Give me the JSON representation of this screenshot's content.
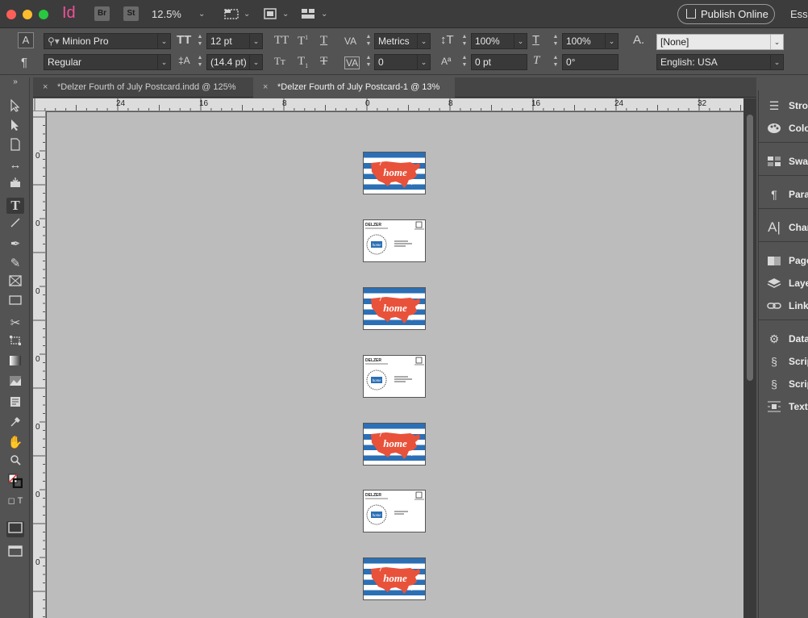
{
  "titlebar": {
    "app_logo": "Id",
    "bridge_label": "Br",
    "stock_label": "St",
    "zoom": "12.5%",
    "publish_label": "Publish Online",
    "workspace_label": "Ess"
  },
  "control": {
    "font_family": "Minion Pro",
    "font_style": "Regular",
    "font_size": "12 pt",
    "leading": "(14.4 pt)",
    "kerning": "Metrics",
    "tracking": "0",
    "vertical_scale": "100%",
    "horizontal_scale": "100%",
    "baseline_shift": "0 pt",
    "skew": "0°",
    "char_style": "[None]",
    "language": "English: USA"
  },
  "tabs": [
    {
      "label": "*Delzer Fourth of July Postcard.indd @ 125%"
    },
    {
      "label": "*Delzer Fourth of July Postcard-1 @ 13%"
    }
  ],
  "ruler": {
    "h_labels": [
      "24",
      "16",
      "8",
      "0",
      "8",
      "16",
      "24",
      "32"
    ],
    "v_labels": [
      "0",
      "0",
      "0",
      "0",
      "0",
      "0",
      "0"
    ]
  },
  "postcard": {
    "front_text": "home",
    "back_brand": "DELZER"
  },
  "panels": [
    {
      "label": "Strol",
      "icon": "stroke-icon"
    },
    {
      "label": "Colo",
      "icon": "color-icon"
    },
    {
      "label": "Swat",
      "icon": "swatches-icon"
    },
    {
      "label": "Para",
      "icon": "paragraph-icon"
    },
    {
      "label": "Char",
      "icon": "character-icon"
    },
    {
      "label": "Page",
      "icon": "pages-icon"
    },
    {
      "label": "Laye",
      "icon": "layers-icon"
    },
    {
      "label": "Link",
      "icon": "links-icon"
    },
    {
      "label": "Data",
      "icon": "data-merge-icon"
    },
    {
      "label": "Scrip",
      "icon": "scripts-icon"
    },
    {
      "label": "Scrip",
      "icon": "script-label-icon"
    },
    {
      "label": "Text",
      "icon": "text-wrap-icon"
    }
  ],
  "colors": {
    "postcard_blue": "#2b6fb5",
    "postcard_red": "#e8523a",
    "app_logo_pink": "#f0509a"
  }
}
